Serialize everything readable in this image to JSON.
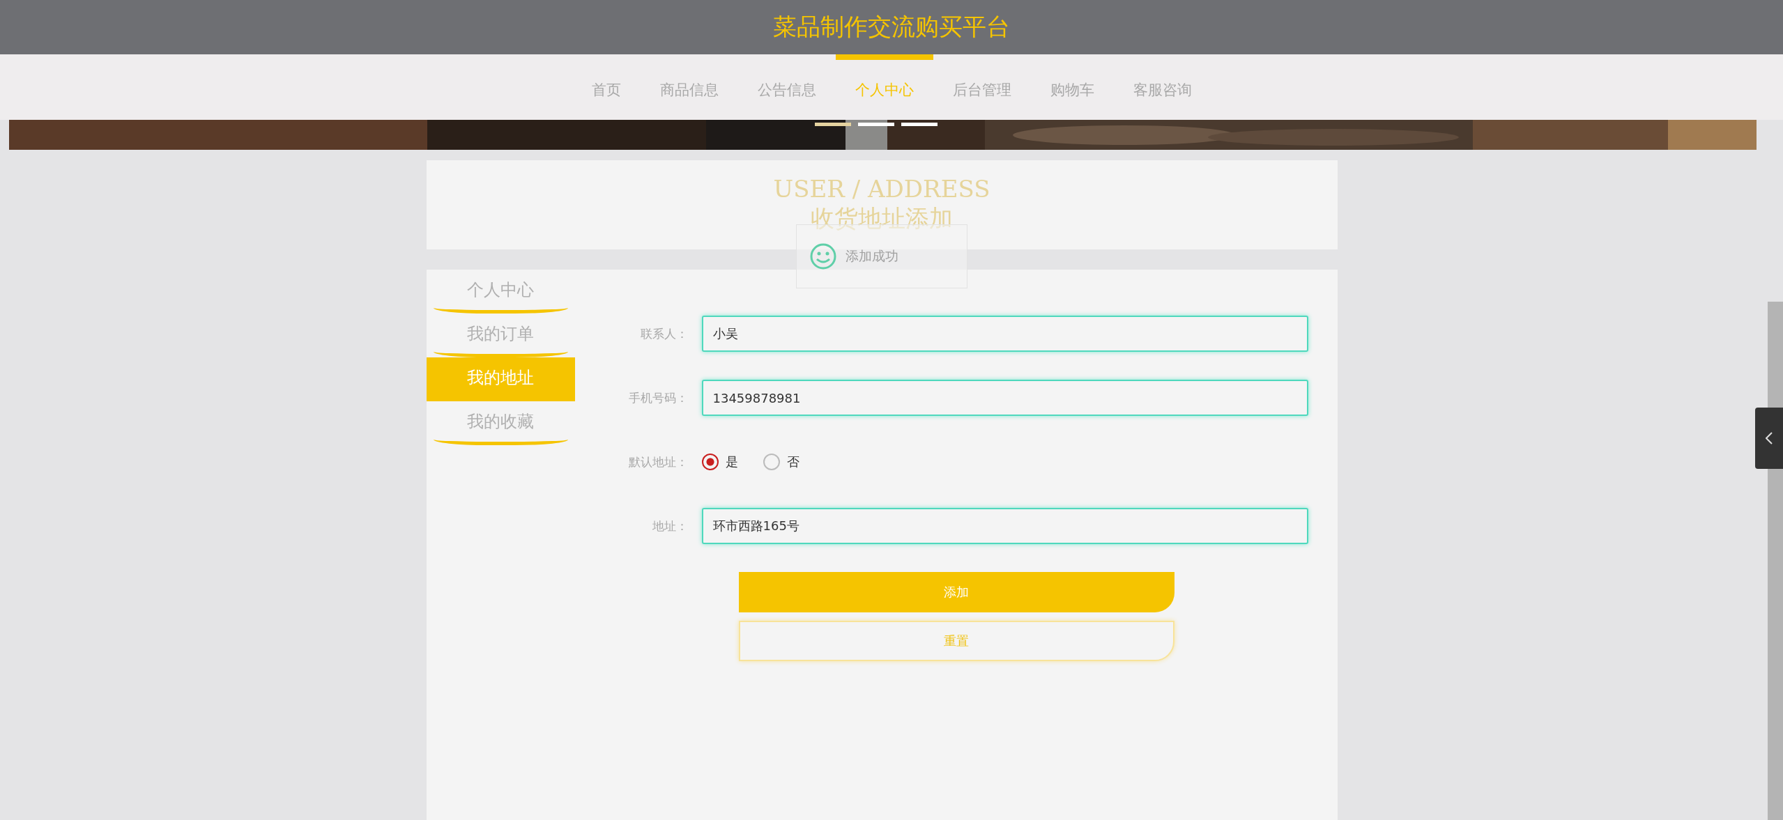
{
  "header": {
    "title": "菜品制作交流购买平台"
  },
  "nav": [
    {
      "label": "首页",
      "selected": false
    },
    {
      "label": "商品信息",
      "selected": false
    },
    {
      "label": "公告信息",
      "selected": false
    },
    {
      "label": "个人中心",
      "selected": true
    },
    {
      "label": "后台管理",
      "selected": false
    },
    {
      "label": "购物车",
      "selected": false
    },
    {
      "label": "客服咨询",
      "selected": false
    }
  ],
  "banner": {
    "slides": [
      {
        "selected": true
      },
      {
        "selected": false
      },
      {
        "selected": false
      }
    ]
  },
  "page_heading": {
    "subtitle": "USER / ADDRESS",
    "title": "收货地址添加"
  },
  "toast": {
    "message": "添加成功"
  },
  "sidebar": [
    {
      "label": "个人中心",
      "selected": false
    },
    {
      "label": "我的订单",
      "selected": false
    },
    {
      "label": "我的地址",
      "selected": true
    },
    {
      "label": "我的收藏",
      "selected": false
    }
  ],
  "form": {
    "fields": [
      {
        "label": "联系人：",
        "kind": "text",
        "value": "小吴"
      },
      {
        "label": "手机号码：",
        "kind": "text",
        "value": "13459878981"
      },
      {
        "label": "默认地址：",
        "kind": "radio",
        "options": [
          {
            "label": "是",
            "selected": true
          },
          {
            "label": "否",
            "selected": false
          }
        ]
      },
      {
        "label": "地址：",
        "kind": "text",
        "value": "环市西路165号"
      }
    ],
    "buttons": [
      {
        "label": "添加",
        "kind": "primary"
      },
      {
        "label": "重置",
        "kind": "secondary"
      }
    ]
  }
}
